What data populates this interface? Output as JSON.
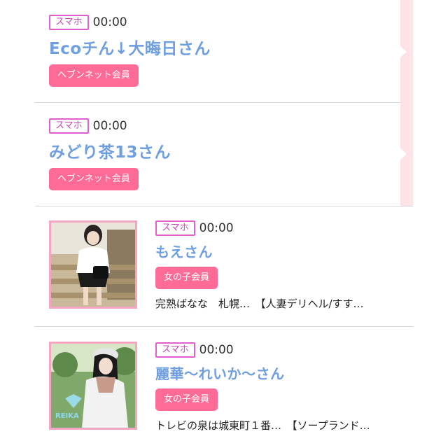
{
  "entries": [
    {
      "device": "スマホ",
      "time": "00:00",
      "name": "Ecoチん↓大晦日さん",
      "member_type": "ヘブンネット会員"
    },
    {
      "device": "スマホ",
      "time": "00:00",
      "name": "みどり茶13さん",
      "member_type": "ヘブンネット会員"
    },
    {
      "device": "スマホ",
      "time": "00:00",
      "name": "もえさん",
      "member_type": "女の子会員",
      "message": "完熟ばなな　札幌…　【人妻デリヘル/すす…",
      "photo": "woman-profile-photo"
    },
    {
      "device": "スマホ",
      "time": "00:00",
      "name": "麗華〜れいか〜さん",
      "member_type": "女の子会員",
      "message": "トレビの泉は城東町１番…　【ソープランド…",
      "photo": "woman-profile-photo",
      "watermark": "REIKA"
    }
  ],
  "colors": {
    "name_link": "#6f9fe0",
    "member_button": "#ff6b97",
    "device_badge_border": "#e060d0",
    "side_strip": "#fde3e6"
  }
}
